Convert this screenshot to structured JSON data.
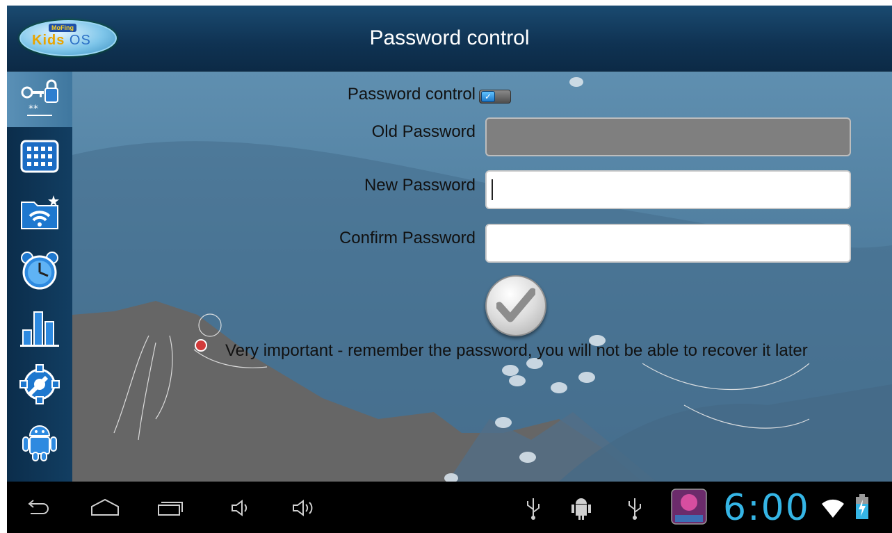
{
  "titlebar": {
    "logo_top": "MoFing",
    "logo_main": "Kids",
    "logo_os": "OS",
    "title": "Password control"
  },
  "sidebar": {
    "items": [
      {
        "name": "password",
        "icon": "key-lock-icon",
        "active": true
      },
      {
        "name": "apps",
        "icon": "app-grid-icon"
      },
      {
        "name": "wifi",
        "icon": "wifi-folder-icon"
      },
      {
        "name": "alarm",
        "icon": "alarm-clock-icon"
      },
      {
        "name": "stats",
        "icon": "bar-chart-icon"
      },
      {
        "name": "settings",
        "icon": "gear-wrench-icon"
      },
      {
        "name": "android",
        "icon": "android-icon"
      }
    ]
  },
  "form": {
    "password_control_label": "Password control",
    "password_control_checked": true,
    "old_password_label": "Old Password",
    "old_password_value": "",
    "new_password_label": "New Password",
    "new_password_value": "",
    "confirm_password_label": "Confirm Password",
    "confirm_password_value": "",
    "confirm_icon": "checkmark-icon",
    "warning": "Very important - remember the password, you will not be able to recover it later"
  },
  "navbar": {
    "clock": "6:00",
    "buttons": [
      "back-icon",
      "home-icon",
      "recent-apps-icon",
      "volume-down-icon",
      "volume-up-icon"
    ],
    "status_icons": [
      "usb-icon",
      "android-debug-icon",
      "usb-icon",
      "kids-os-app-icon",
      "wifi-icon",
      "battery-charging-icon"
    ],
    "accent_color": "#35b5e5"
  }
}
